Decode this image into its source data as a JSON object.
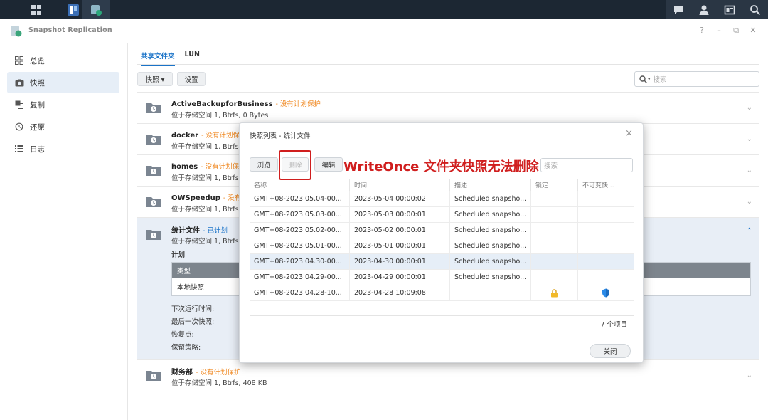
{
  "app": {
    "title": "Snapshot Replication",
    "window_controls": {
      "help": "?",
      "minimize": "–",
      "maximize": "⧉",
      "close": "✕"
    }
  },
  "sidebar": {
    "items": [
      {
        "label": "总览",
        "icon": "grid-icon"
      },
      {
        "label": "快照",
        "icon": "camera-icon",
        "active": true
      },
      {
        "label": "复制",
        "icon": "replicate-icon"
      },
      {
        "label": "还原",
        "icon": "restore-icon"
      },
      {
        "label": "日志",
        "icon": "list-icon"
      }
    ]
  },
  "tabs": [
    {
      "label": "共享文件夹",
      "active": true
    },
    {
      "label": "LUN"
    }
  ],
  "toolbar": {
    "snapshot_label": "快照 ▾",
    "settings_label": "设置",
    "search_placeholder": "搜索"
  },
  "folders": [
    {
      "name": "ActiveBackupforBusiness",
      "status": "- 没有计划保护",
      "location": "位于存储空间 1, Btrfs, 0 Bytes"
    },
    {
      "name": "docker",
      "status": "- 没有计划保护",
      "location": "位于存储空间 1, Btrfs"
    },
    {
      "name": "homes",
      "status": "- 没有计划保护",
      "location": "位于存储空间 1, Btrfs"
    },
    {
      "name": "OWSpeedup",
      "status": "- 没有计划保护",
      "location": "位于存储空间 1, Btrfs"
    },
    {
      "name": "统计文件",
      "status": "- 已计划",
      "location": "位于存储空间 1, Btrfs"
    },
    {
      "name": "财务部",
      "status": "- 没有计划保护",
      "location": "位于存储空间 1, Btrfs, 408 KB"
    }
  ],
  "plan": {
    "title": "计划",
    "header": "类型",
    "value": "本地快照",
    "next_run": "下次运行时间:",
    "last_snapshot": "最后一次快照:",
    "restore_point": "恢复点:",
    "retention": "保留策略:"
  },
  "dialog": {
    "title": "快照列表 - 统计文件",
    "browse": "浏览",
    "delete": "删除",
    "edit": "编辑",
    "search_placeholder": "搜索",
    "annotation": "WriteOnce 文件夹快照无法删除",
    "columns": [
      "名称",
      "时间",
      "描述",
      "锁定",
      "不可变快..."
    ],
    "rows": [
      {
        "name": "GMT+08-2023.05.04-00...",
        "time": "2023-05-04 00:00:02",
        "desc": "Scheduled snapsho...",
        "locked": false,
        "immutable": false
      },
      {
        "name": "GMT+08-2023.05.03-00...",
        "time": "2023-05-03 00:00:01",
        "desc": "Scheduled snapsho...",
        "locked": false,
        "immutable": false
      },
      {
        "name": "GMT+08-2023.05.02-00...",
        "time": "2023-05-02 00:00:01",
        "desc": "Scheduled snapsho...",
        "locked": false,
        "immutable": false
      },
      {
        "name": "GMT+08-2023.05.01-00...",
        "time": "2023-05-01 00:00:01",
        "desc": "Scheduled snapsho...",
        "locked": false,
        "immutable": false
      },
      {
        "name": "GMT+08-2023.04.30-00...",
        "time": "2023-04-30 00:00:01",
        "desc": "Scheduled snapsho...",
        "locked": false,
        "immutable": false,
        "selected": true
      },
      {
        "name": "GMT+08-2023.04.29-00...",
        "time": "2023-04-29 00:00:01",
        "desc": "Scheduled snapsho...",
        "locked": false,
        "immutable": false
      },
      {
        "name": "GMT+08-2023.04.28-10...",
        "time": "2023-04-28 10:09:08",
        "desc": "",
        "locked": true,
        "immutable": true
      }
    ],
    "count": "7 个项目",
    "close": "关闭"
  },
  "colors": {
    "accent": "#1a73c8",
    "warning": "#f08a24",
    "annotation": "#d01e1e",
    "taskbar": "#1c2733"
  }
}
